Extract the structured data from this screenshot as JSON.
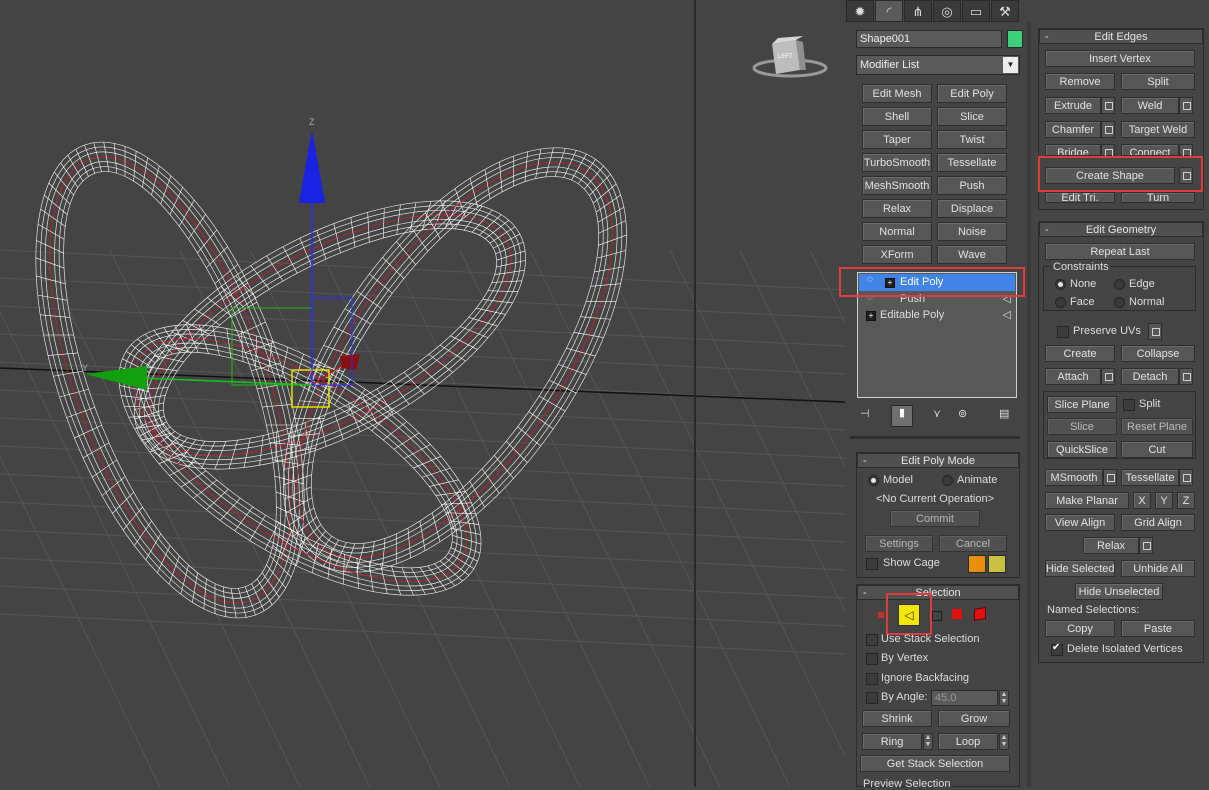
{
  "viewport": {
    "gizmo_axis_z": "Z",
    "gizmo_axis_y": "Y",
    "viewcube_label": "LEFT"
  },
  "command_panel": {
    "tabs": [
      "create-icon",
      "modify-icon",
      "hierarchy-icon",
      "motion-icon",
      "display-icon",
      "utilities-icon"
    ],
    "object_name": "Shape001",
    "object_color": "#3cd07a",
    "modifier_list_label": "Modifier List",
    "modifier_buttons": [
      "Edit Mesh",
      "Edit Poly",
      "Shell",
      "Slice",
      "Taper",
      "Twist",
      "TurboSmooth",
      "Tessellate",
      "MeshSmooth",
      "Push",
      "Relax",
      "Displace",
      "Normal",
      "Noise",
      "XForm",
      "Wave"
    ],
    "stack": [
      {
        "label": "Edit Poly",
        "selected": true
      },
      {
        "label": "Push",
        "selected": false
      },
      {
        "label": "Editable Poly",
        "selected": false
      }
    ]
  },
  "edit_poly_mode": {
    "title": "Edit Poly Mode",
    "model_label": "Model",
    "animate_label": "Animate",
    "current_op": "<No Current Operation>",
    "commit_label": "Commit",
    "settings_label": "Settings",
    "cancel_label": "Cancel",
    "show_cage_label": "Show Cage",
    "cage_color_1": "#e8900a",
    "cage_color_2": "#c8c040"
  },
  "selection": {
    "title": "Selection",
    "use_stack_label": "Use Stack Selection",
    "by_vertex_label": "By Vertex",
    "ignore_backfacing_label": "Ignore Backfacing",
    "by_angle_label": "By Angle:",
    "angle_value": "45.0",
    "shrink_label": "Shrink",
    "grow_label": "Grow",
    "ring_label": "Ring",
    "loop_label": "Loop",
    "get_stack_label": "Get Stack Selection",
    "preview_label": "Preview Selection"
  },
  "edit_edges": {
    "title": "Edit Edges",
    "insert_vertex": "Insert Vertex",
    "remove": "Remove",
    "split": "Split",
    "extrude": "Extrude",
    "weld": "Weld",
    "chamfer": "Chamfer",
    "target_weld": "Target Weld",
    "bridge": "Bridge",
    "connect": "Connect",
    "create_shape": "Create Shape",
    "edit_tri": "Edit Tri.",
    "turn": "Turn"
  },
  "edit_geometry": {
    "title": "Edit Geometry",
    "repeat_last": "Repeat Last",
    "constraints_label": "Constraints",
    "none": "None",
    "edge": "Edge",
    "face": "Face",
    "normal": "Normal",
    "preserve_uvs": "Preserve UVs",
    "create": "Create",
    "collapse": "Collapse",
    "attach": "Attach",
    "detach": "Detach",
    "slice_plane": "Slice Plane",
    "split": "Split",
    "slice": "Slice",
    "reset_plane": "Reset Plane",
    "quickslice": "QuickSlice",
    "cut": "Cut",
    "msmooth": "MSmooth",
    "tessellate": "Tessellate",
    "make_planar": "Make Planar",
    "x": "X",
    "y": "Y",
    "z": "Z",
    "view_align": "View Align",
    "grid_align": "Grid Align",
    "relax": "Relax",
    "hide_selected": "Hide Selected",
    "unhide_all": "Unhide All",
    "hide_unselected": "Hide Unselected",
    "named_selections": "Named Selections:",
    "copy": "Copy",
    "paste": "Paste",
    "delete_isolated": "Delete Isolated Vertices"
  }
}
